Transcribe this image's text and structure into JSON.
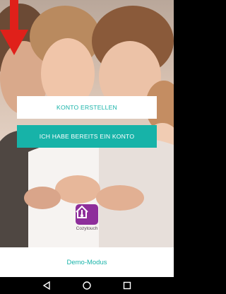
{
  "buttons": {
    "create_account": "KONTO ERSTELLEN",
    "have_account": "ICH HABE BEREITS EIN KONTO"
  },
  "logo": {
    "label": "Cozytouch"
  },
  "demo": {
    "label": "Demo-Modus"
  },
  "colors": {
    "accent": "#17b3a8",
    "arrow": "#e0201a",
    "logo_bg": "#8e2e9b",
    "nav_bg": "#000000"
  },
  "icons": {
    "arrow": "down-arrow-icon",
    "logo": "house-thermometer-icon",
    "back": "back-triangle-icon",
    "home": "home-circle-icon",
    "recents": "recents-square-icon"
  }
}
